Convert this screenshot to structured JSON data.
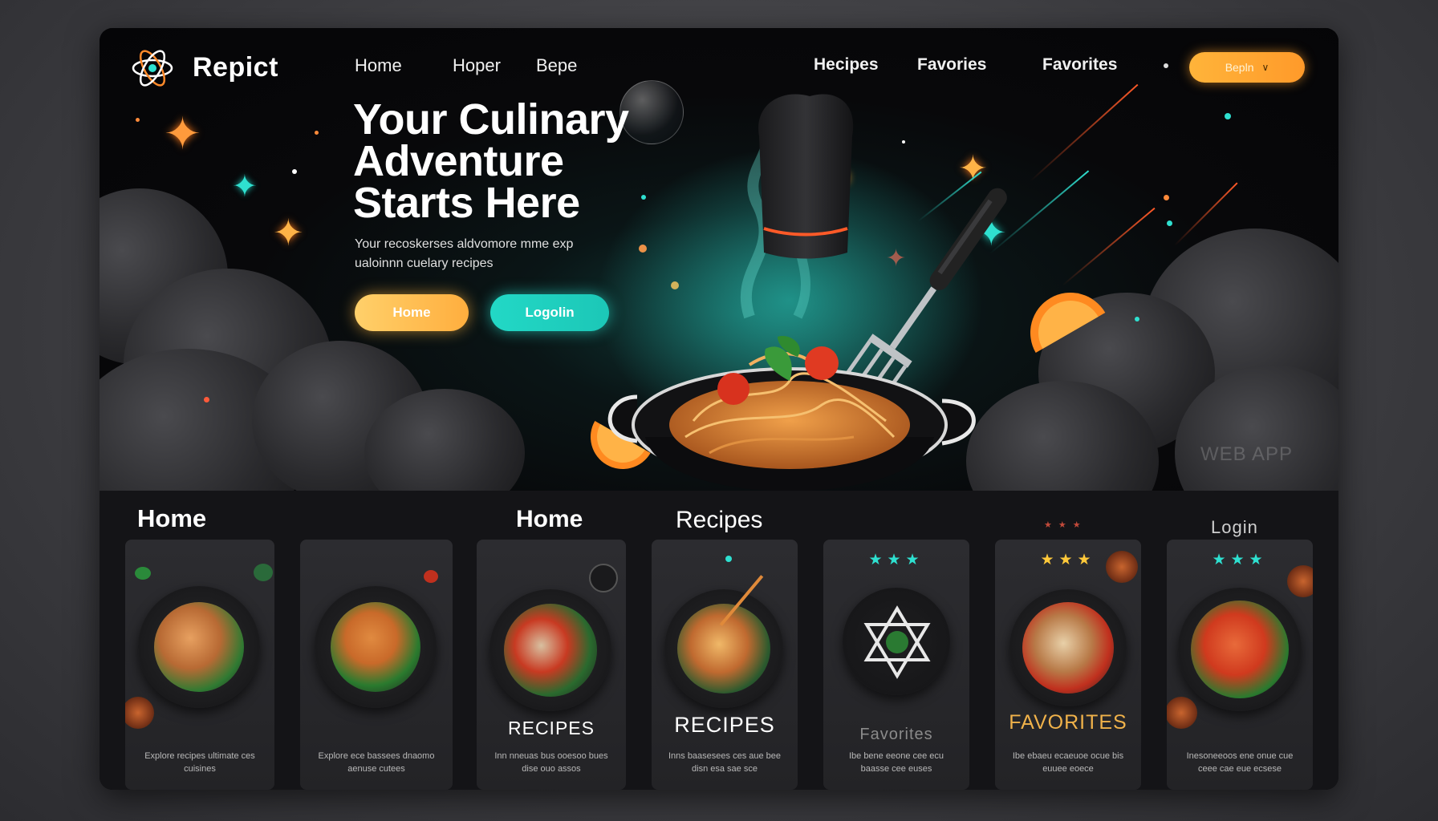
{
  "app": {
    "name": "Repict"
  },
  "nav": {
    "links": [
      "Home",
      "Hoper",
      "Bepe"
    ],
    "right_links": [
      "Hecipes",
      "Favories",
      "Favorites"
    ],
    "cta_label": "Bepln"
  },
  "hero": {
    "headline": "Your Culinary Adventure Starts Here",
    "subtext": "Your recoskerses aldvomore mme exp ualoinnn cuelary recipes",
    "primary_button": "Home",
    "secondary_button": "Logolin",
    "watermark": "WEB APP"
  },
  "section": {
    "title_left": "Home",
    "title_mid": "Home",
    "title_recipes": "Recipes",
    "login": "Login"
  },
  "cards": [
    {
      "title": "",
      "desc": "Explore recipes ultimate ces cuisines"
    },
    {
      "title": "",
      "desc": "Explore ece bassees dnaomo aenuse cutees"
    },
    {
      "title": "RECIPES",
      "desc": "Inn nneuas bus ooesoo bues dise ouo assos"
    },
    {
      "title": "RECIPES",
      "desc": "Inns baasesees ces aue bee disn esa sae sce"
    },
    {
      "title": "Favorites",
      "desc": "Ibe bene eeone cee ecu baasse cee euses"
    },
    {
      "title": "FAVORITES",
      "desc": "Ibe ebaeu ecaeuoe ocue bis euuee eoece"
    },
    {
      "title": "",
      "desc": "Inesoneeoos ene onue cue ceee cae eue ecsese"
    }
  ],
  "colors": {
    "accent_orange": "#ffae3e",
    "accent_teal": "#22d8c6",
    "background": "#0d0d10"
  }
}
